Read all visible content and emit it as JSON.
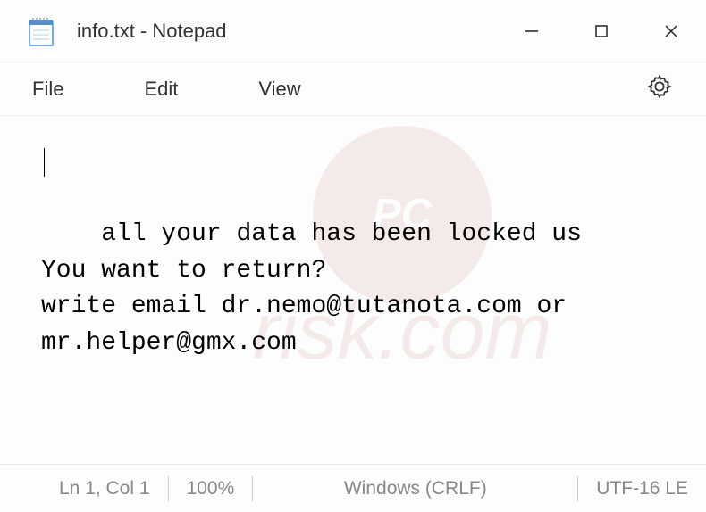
{
  "titlebar": {
    "title": "info.txt - Notepad"
  },
  "menubar": {
    "file": "File",
    "edit": "Edit",
    "view": "View"
  },
  "content": {
    "text": "all your data has been locked us\nYou want to return?\nwrite email dr.nemo@tutanota.com or mr.helper@gmx.com"
  },
  "statusbar": {
    "position": "Ln 1, Col 1",
    "zoom": "100%",
    "lineending": "Windows (CRLF)",
    "encoding": "UTF-16 LE"
  },
  "watermark": {
    "circle": "PC",
    "text": "risk.com"
  }
}
